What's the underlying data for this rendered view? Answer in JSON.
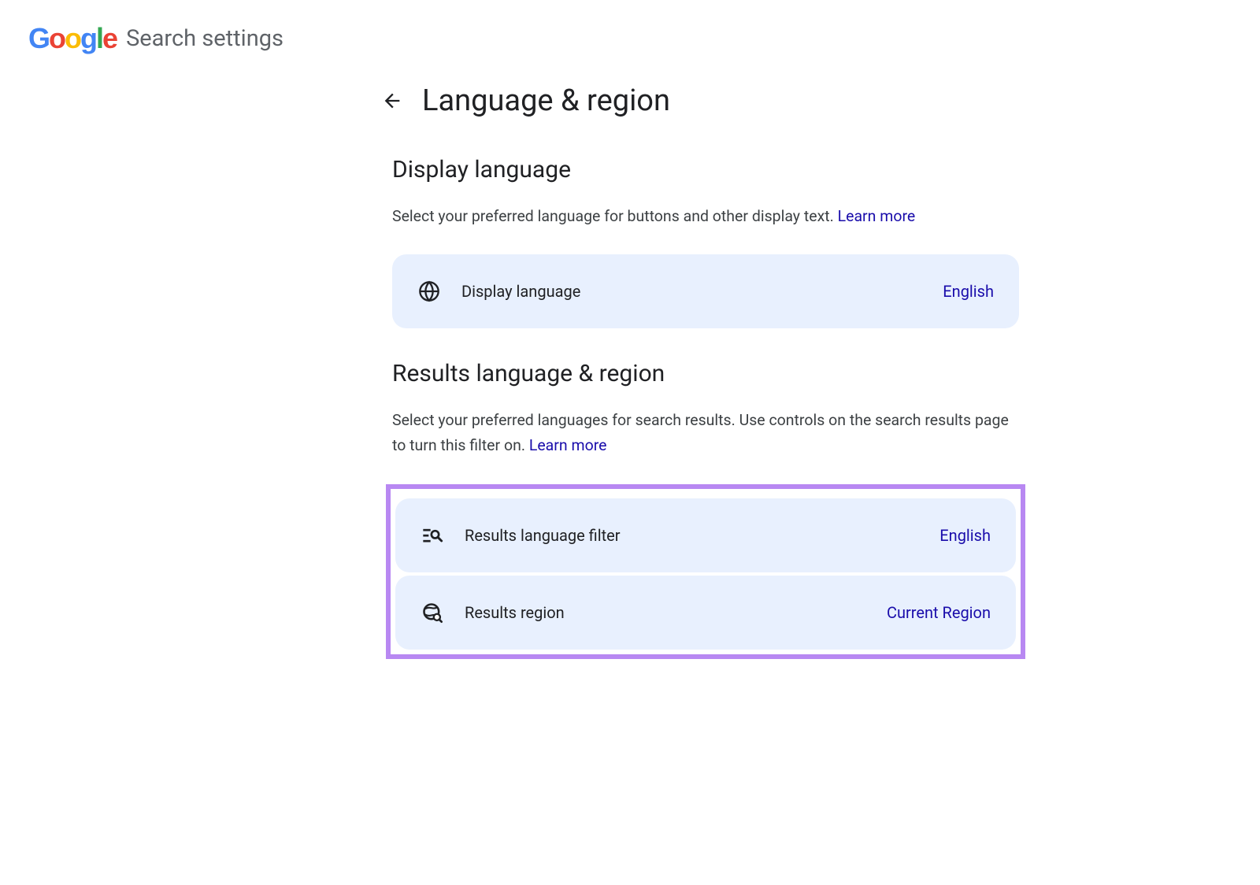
{
  "header": {
    "title": "Search settings"
  },
  "page": {
    "title": "Language & region"
  },
  "sections": {
    "display_language": {
      "title": "Display language",
      "description": "Select your preferred language for buttons and other display text. ",
      "learn_more": "Learn more",
      "card": {
        "label": "Display language",
        "value": "English"
      }
    },
    "results_language_region": {
      "title": "Results language & region",
      "description": "Select your preferred languages for search results. Use controls on the search results page to turn this filter on. ",
      "learn_more": "Learn more",
      "cards": {
        "filter": {
          "label": "Results language filter",
          "value": "English"
        },
        "region": {
          "label": "Results region",
          "value": "Current Region"
        }
      }
    }
  }
}
